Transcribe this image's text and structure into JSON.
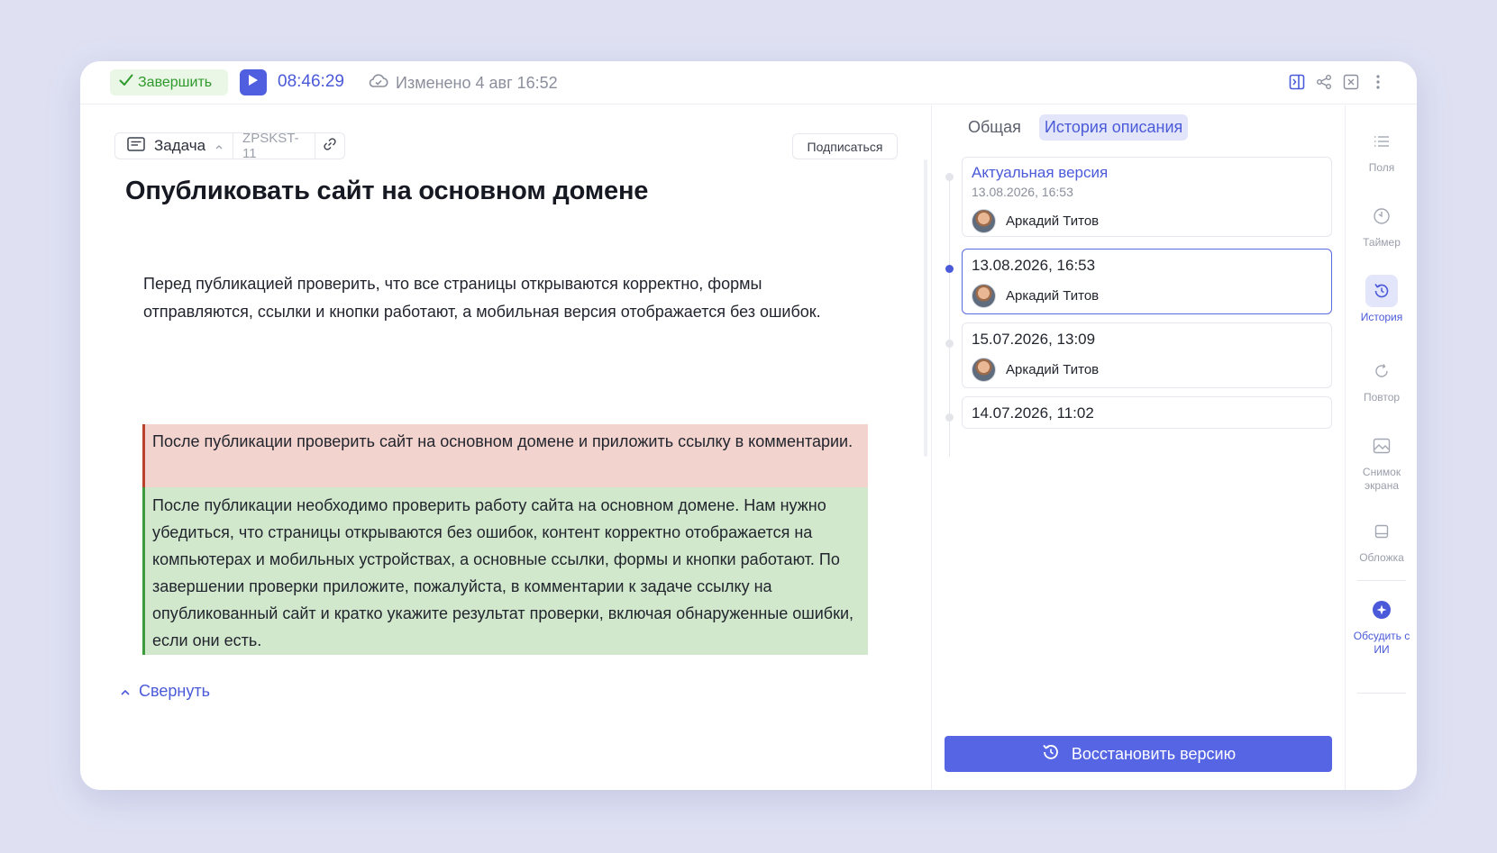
{
  "topbar": {
    "complete_label": "Завершить",
    "timer": "08:46:29",
    "modified": "Изменено 4 авг 16:52"
  },
  "task": {
    "type_label": "Задача",
    "key": "ZPSKST-11",
    "subscribe_label": "Подписаться",
    "title": "Опубликовать сайт на основном домене",
    "description": "Перед публикацией проверить, что все страницы открываются корректно, формы отправляются, ссылки и кнопки работают, а мобильная версия отображается без ошибок.",
    "removed_text": "После публикации проверить сайт на основном домене и приложить ссылку в комментарии.",
    "added_text": "После публикации необходимо проверить работу сайта на основном домене. Нам нужно убедиться, что страницы открываются без ошибок, контент корректно отображается на компьютерах и мобильных устройствах, а основные ссылки, формы и кнопки работают. По завершении проверки приложите, пожалуйста, в комментарии к задаче ссылку на опубликованный сайт и кратко укажите результат проверки, включая обнаруженные ошибки, если они есть.",
    "collapse_label": "Свернуть"
  },
  "history": {
    "tabs": [
      {
        "label": "Общая",
        "active": false
      },
      {
        "label": "История описания",
        "active": true
      }
    ],
    "versions": [
      {
        "title": "Актуальная версия",
        "date": "13.08.2026, 16:53",
        "author": "Аркадий Титов",
        "current": true
      },
      {
        "title": "13.08.2026, 16:53",
        "author": "Аркадий Титов",
        "selected": true
      },
      {
        "title": "15.07.2026, 13:09",
        "author": "Аркадий Титов"
      },
      {
        "title": "14.07.2026, 11:02"
      }
    ],
    "restore_label": "Восстановить версию"
  },
  "rail": [
    {
      "label": "Поля",
      "icon": "list-icon"
    },
    {
      "label": "Таймер",
      "icon": "timer-icon"
    },
    {
      "label": "История",
      "icon": "history-icon",
      "active": true
    },
    {
      "label": "Повтор",
      "icon": "repeat-icon"
    },
    {
      "label": "Снимок экрана",
      "icon": "image-icon"
    },
    {
      "label": "Обложка",
      "icon": "cover-icon"
    },
    {
      "label": "Обсудить с ИИ",
      "icon": "ai-icon"
    }
  ],
  "colors": {
    "accent": "#4a5ad8",
    "removed_bg": "#f2d3cd",
    "added_bg": "#d1e8cc",
    "complete_green": "#2f9a2c"
  }
}
